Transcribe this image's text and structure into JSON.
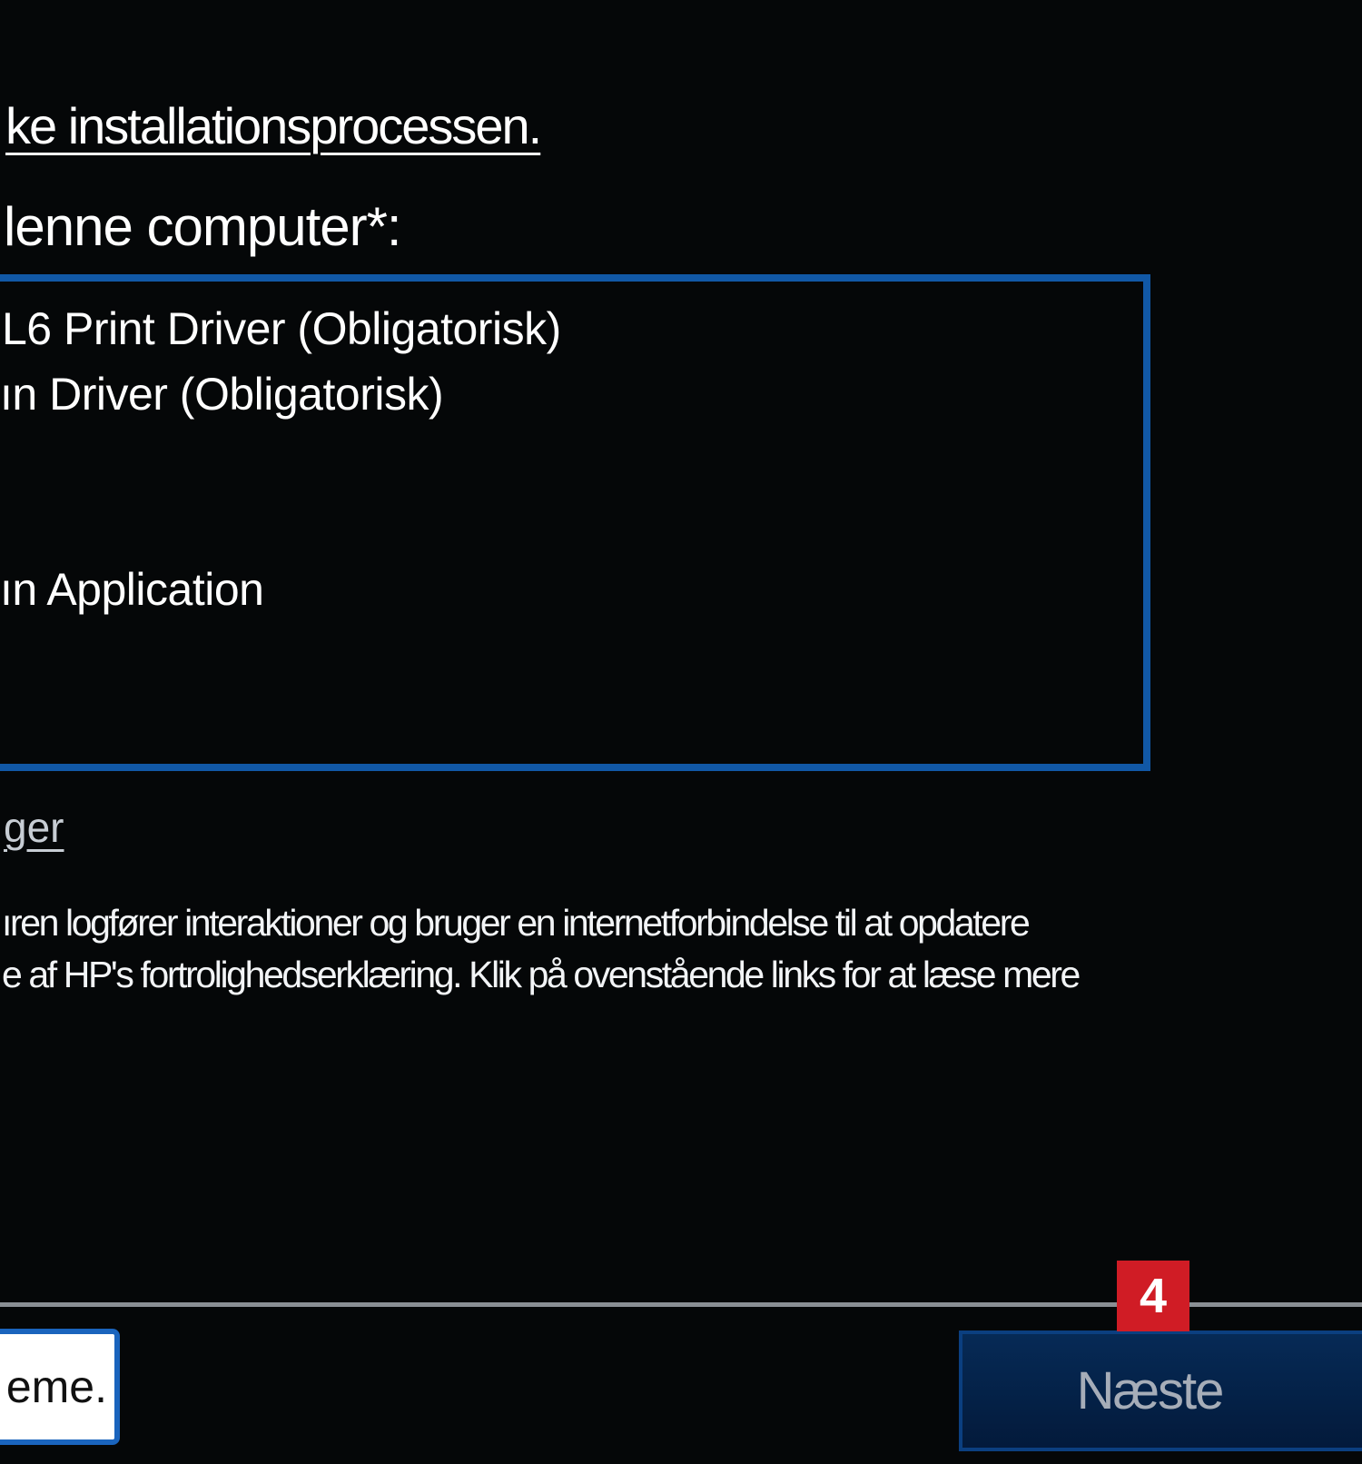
{
  "installer": {
    "top_link": "ke installationsprocessen.",
    "section_heading": "lenne computer*:"
  },
  "drivers": {
    "items": [
      "L6 Print Driver  (Obligatorisk)",
      "ın Driver  (Obligatorisk)",
      "ın Application"
    ]
  },
  "privacy": {
    "link": "ger",
    "lines": [
      "ıren logfører interaktioner og bruger en internetforbindelse til at opdatere",
      "e af HP's fortrolighedserklæring. Klik på ovenstående links for at læse mere"
    ]
  },
  "footer": {
    "left_button_label": "eme.",
    "next_button_label": "Næste",
    "step_badge": "4"
  },
  "colors": {
    "background": "#050708",
    "box_border": "#1158a6",
    "next_button": "#052549",
    "badge": "#d01c25"
  }
}
